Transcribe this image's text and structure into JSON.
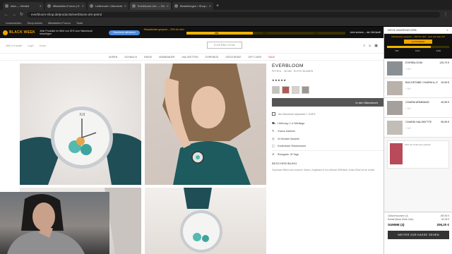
{
  "browser": {
    "tabs": [
      {
        "title": "elba — Webkit",
        "active": false
      },
      {
        "title": "Mitarbeiter-Forum | Kundendienst",
        "active": false
      },
      {
        "title": "Lettermail • Übersicht",
        "active": false
      },
      {
        "title": "Everbloom Uhr — Shop",
        "active": true
      },
      {
        "title": "Bestellungen • Shop Admin",
        "active": false
      }
    ],
    "new_tab": "+",
    "url": "everbloom-shop.de/products/everbloom-uhr-petrol",
    "bookmarks": [
      "Lesezeichen",
      "Shop Admin",
      "Mitarbeiter-Forum",
      "Tools"
    ]
  },
  "promo_bar": {
    "logo": "BLACK WEEK",
    "message": "Jetzt Produkte im Wert von 50 € zum Warenkorb hinzufügen",
    "pill": "Geschenk aktivieren",
    "tier_label": "Rabattstufen gesperrt – 25% für dich",
    "tiers": [
      "€50",
      "€100",
      "€150"
    ],
    "progress": 0.42,
    "cta": "Jetzt sichern – die Zeit läuft!"
  },
  "header": {
    "links": [
      "Hilfe & Kontakt",
      "Login",
      "Konto"
    ],
    "brand": "EVERBLOOM",
    "icons": [
      "search-icon",
      "user-icon",
      "bag-icon"
    ]
  },
  "menu": [
    "UHREN",
    "SCHMUCK",
    "RINGE",
    "ARMBÄNDER",
    "HALSKETTEN",
    "OHRRINGE",
    "GESCHENKE",
    "GIFT CARD",
    "SALE"
  ],
  "product": {
    "title": "EVERBLOOM",
    "subtitle": "PETROL · 38 MM · ECHTE BLUMEN",
    "stars": "★★★★★",
    "add_to_cart": "In den Warenkorb",
    "gift_option": "Als Geschenk verpacken + 5,95 €",
    "features": [
      {
        "icon": "truck-icon",
        "text": "Lieferung: 2–4 Werktage"
      },
      {
        "icon": "pen-icon",
        "text": "Gravur ansehen"
      },
      {
        "icon": "clock-icon",
        "text": "24 Monate Garantie"
      },
      {
        "icon": "box-icon",
        "text": "Kostenloser Rückversand"
      },
      {
        "icon": "return-icon",
        "text": "Rückgabe: 30 Tage"
      }
    ],
    "description_heading": "BESCHREIBUNG",
    "description": "Gepresste Blüten aus unserem Garten, eingefasst in ein zeitloses Zifferblatt. Jedes Stück ist ein Unikat."
  },
  "cart": {
    "heading": "DEIN WARENKORB",
    "close": "×",
    "promo_message": "Rabattstufen gesperrt – 25% für dich · Jetzt auf Sale-Teil",
    "promo_button": "GLÜCKSRAD",
    "tier_labels": [
      "€50",
      "€100",
      "€150"
    ],
    "progress": 0.7,
    "items": [
      {
        "name": "EVERBLOOM",
        "qty": "− 1 +",
        "price": "129,70 €"
      },
      {
        "name": "BUCHSTABE CHARM A–Z",
        "qty": "− 1 +",
        "price": "29,95 €"
      },
      {
        "name": "CHARM ARMBAND",
        "qty": "− 1 +",
        "price": "49,95 €"
      },
      {
        "name": "CHARM HALSKETTE",
        "qty": "− 1 +",
        "price": "59,95 €"
      }
    ],
    "upsell_text": "Wird oft zusammen gekauft",
    "totals": [
      {
        "label": "Zwischensumme (4)",
        "value": "269,55 €"
      },
      {
        "label": "Rabatt (Black Week Sale)",
        "value": "−69,95 €"
      }
    ],
    "sum_label": "SUMME (4)",
    "sum_value": "206,20 €",
    "checkout": "WEITER ZUR KASSE GEHEN"
  }
}
